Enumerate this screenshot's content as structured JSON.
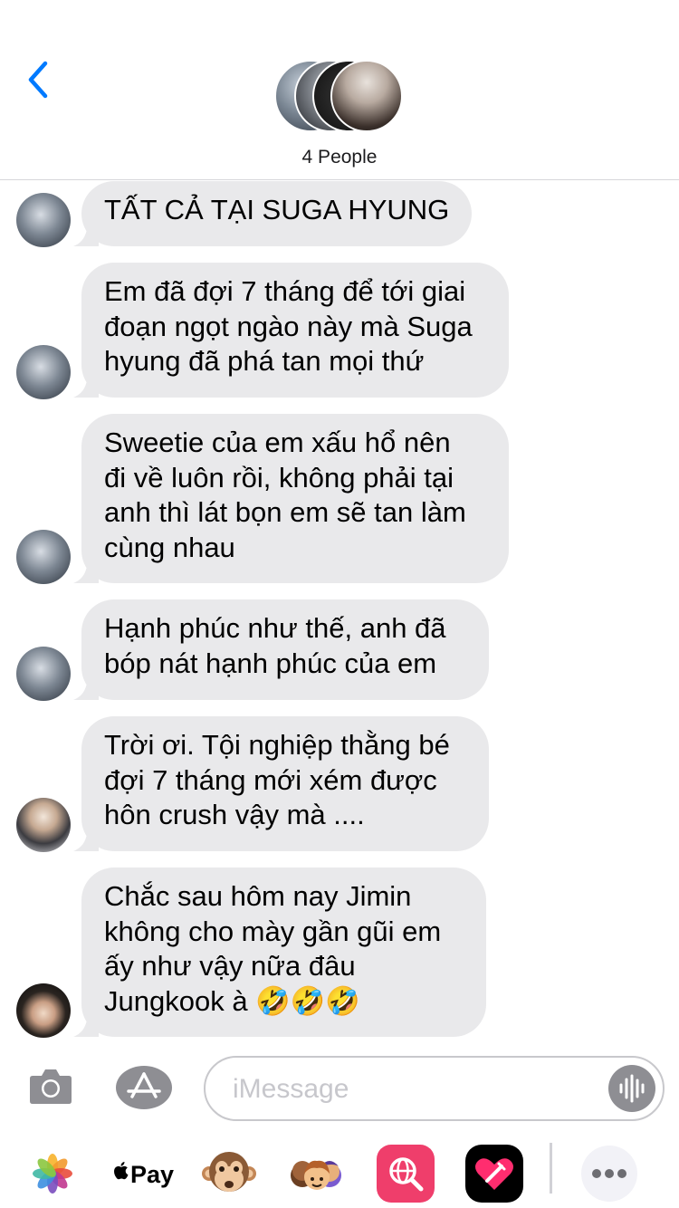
{
  "header": {
    "group_label": "4 People"
  },
  "messages": [
    {
      "text": "TẤT CẢ TẠI SUGA HYUNG"
    },
    {
      "text": "Em đã đợi 7 tháng để tới giai\nđoạn ngọt ngào này mà Suga\nhyung đã phá tan mọi thứ"
    },
    {
      "text": "Sweetie của em xấu hổ nên\nđi về luôn rồi, không phải tại\nanh thì lát bọn em sẽ tan làm\ncùng nhau"
    },
    {
      "text": "Hạnh phúc như thế, anh đã\nbóp nát hạnh phúc của em"
    },
    {
      "text": "Trời ơi. Tội nghiệp thằng bé\nđợi 7 tháng mới xém được\nhôn crush vậy mà ...."
    },
    {
      "text": "Chắc sau hôm nay Jimin\nkhông cho mày gần gũi em\nấy như vậy nữa đâu\nJungkook à 🤣🤣🤣"
    }
  ],
  "input": {
    "placeholder": "iMessage"
  },
  "drawer": {
    "apple_pay_label": "Pay",
    "icons": [
      "photos-icon",
      "apple-pay-icon",
      "monkey-animoji-icon",
      "memoji-icon",
      "web-search-icon",
      "digital-touch-icon",
      "more-icon"
    ]
  },
  "colors": {
    "accent": "#007aff",
    "bubble": "#e9e9eb",
    "battery": "#f8cc1b",
    "separator": "#d6d6da"
  }
}
